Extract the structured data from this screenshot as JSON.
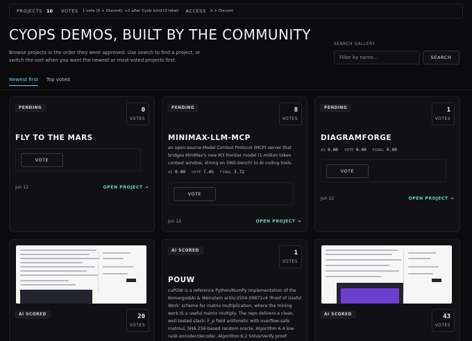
{
  "stats": {
    "projects_label": "PROJECTS",
    "projects_value": "10",
    "votes_label": "VOTES",
    "votes_text": "1 vote (X + Discord); +2 after Cysic bind (3 total)",
    "access_label": "ACCESS",
    "access_text": "X + Discord"
  },
  "page": {
    "title": "CYOPS DEMOS, BUILT BY THE COMMUNITY",
    "intro": "Browse projects in the order they were approved. Use search to find a project, or switch the sort when you want the newest or most-voted projects first."
  },
  "search": {
    "label": "SEARCH GALLERY",
    "placeholder": "Filter by name...",
    "button": "SEARCH"
  },
  "tabs": [
    {
      "label": "Newest first",
      "active": true
    },
    {
      "label": "Top voted",
      "active": false
    }
  ],
  "cards": [
    {
      "badge": "PENDING",
      "votes": "0",
      "votes_label": "VOTES",
      "title": "FLY TO THE MARS",
      "vote_button": "VOTE",
      "date": "Jun 12",
      "open": "OPEN PROJECT →"
    },
    {
      "badge": "PENDING",
      "votes": "8",
      "votes_label": "VOTES",
      "title": "MINIMAX-LLM-MCP",
      "description": "an open-source Model Context Protocol (MCP) server that bridges MiniMax's new M3 frontier model (1 million token context window, strong on SWE-bench) to AI coding tools.",
      "scores": {
        "ai_label": "AI",
        "ai": "0.00",
        "vote_label": "VOTE",
        "vote": "7.45",
        "final_label": "FINAL",
        "final": "3.72"
      },
      "vote_button": "VOTE",
      "date": "Jun 12",
      "open": "OPEN PROJECT →"
    },
    {
      "badge": "PENDING",
      "votes": "1",
      "votes_label": "VOTES",
      "title": "DIAGRAMFORGE",
      "scores": {
        "ai_label": "AI",
        "ai": "0.00",
        "vote_label": "VOTE",
        "vote": "0.00",
        "final_label": "FINAL",
        "final": "0.00"
      },
      "vote_button": "VOTE",
      "date": "Jun 12",
      "open": "OPEN PROJECT →"
    },
    {
      "badge": "AI SCORED",
      "votes": "20",
      "votes_label": "VOTES"
    },
    {
      "badge": "AI SCORED",
      "votes": "1",
      "votes_label": "VOTES",
      "title": "POUW",
      "description": "cuPOW is a reference Python/NumPy implementation of the Komargodski & Weinstein arXiv:2504.09971v4 'Proof of Useful Work' scheme for matrix multiplication, where the mining work IS a useful matrix multiply. The repo delivers a clean, well-tested stack: F_p field arithmetic with overflow-safe matmul, SHA-256-based random oracle, Algorithm 6.4 low-rank encoder/decoder, Algorithm 6.2 Solve/Verify proof system, a"
    },
    {
      "badge": "AI SCORED",
      "votes": "43",
      "votes_label": "VOTES"
    }
  ],
  "colors": {
    "accent_tab": "#7cc9f3",
    "open_link": "#6fd0c4",
    "background": "#0b0b0d"
  }
}
